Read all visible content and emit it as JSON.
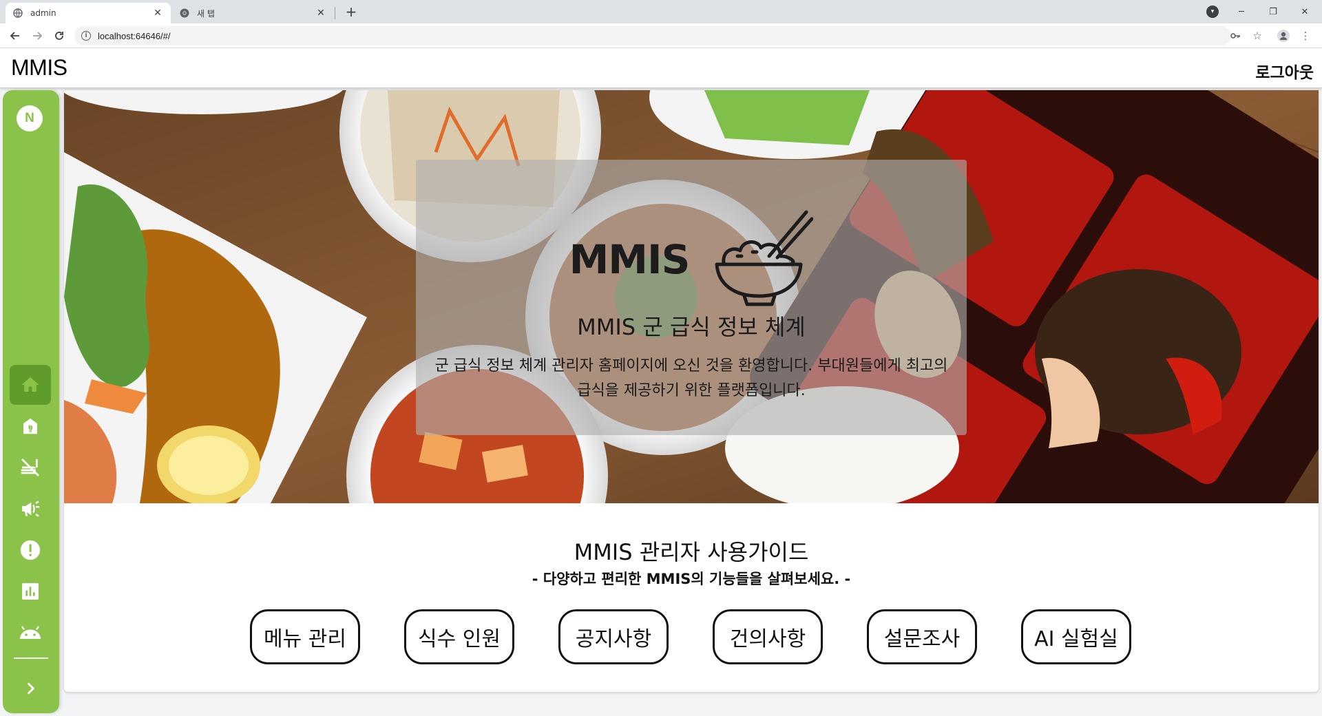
{
  "browser": {
    "tabs": [
      {
        "title": "admin",
        "active": true
      },
      {
        "title": "새 탭",
        "active": false
      }
    ],
    "new_tab": "+",
    "url": "localhost:64646/#/",
    "window_controls": {
      "minimize": "─",
      "restore": "❐",
      "close": "✕"
    }
  },
  "header": {
    "title": "MMIS",
    "logout_label": "로그아웃"
  },
  "sidebar": {
    "avatar_initial": "N",
    "accent_color": "#8bc34a",
    "active_color": "#5f9c2c",
    "items": [
      {
        "name": "home",
        "icon": "home-icon",
        "active": true
      },
      {
        "name": "restaurant-menu",
        "icon": "restaurant-icon",
        "active": false
      },
      {
        "name": "no-meals",
        "icon": "no-meals-icon",
        "active": false
      },
      {
        "name": "announcement",
        "icon": "megaphone-icon",
        "active": false
      },
      {
        "name": "suggestions",
        "icon": "alert-icon",
        "active": false
      },
      {
        "name": "statistics",
        "icon": "bar-chart-icon",
        "active": false
      },
      {
        "name": "ai-lab",
        "icon": "android-icon",
        "active": false
      }
    ],
    "expand_icon": "chevron-right-icon"
  },
  "hero": {
    "brand": "MMIS",
    "heading": "MMIS 군 급식 정보 체계",
    "description": "군 급식 정보 체계 관리자 홈페이지에 오신 것을 환영합니다. 부대원들에게 최고의 급식을 제공하기 위한 플랫폼입니다."
  },
  "guide": {
    "title": "MMIS 관리자 사용가이드",
    "subtitle": "- 다양하고 편리한 MMIS의 기능들을 살펴보세요. -",
    "buttons": [
      {
        "label": "메뉴 관리"
      },
      {
        "label": "식수 인원"
      },
      {
        "label": "공지사항"
      },
      {
        "label": "건의사항"
      },
      {
        "label": "설문조사"
      },
      {
        "label": "AI 실험실"
      }
    ]
  }
}
